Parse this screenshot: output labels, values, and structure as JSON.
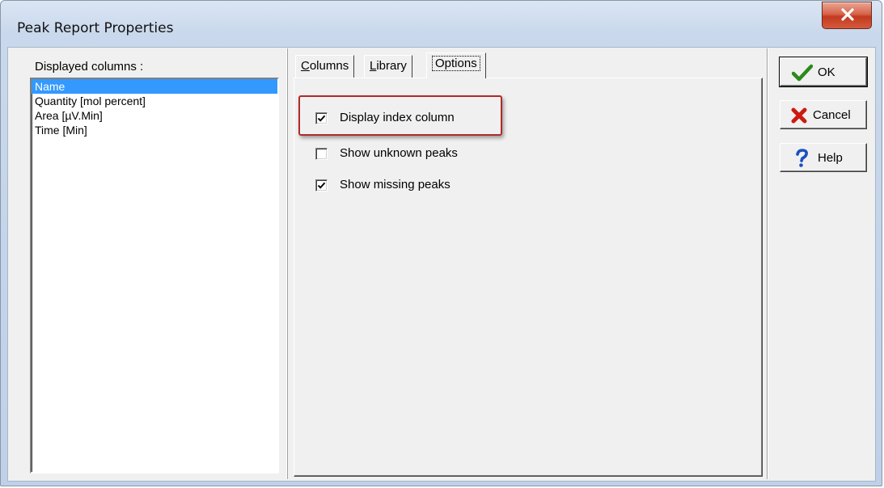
{
  "window": {
    "title": "Peak Report Properties"
  },
  "left_panel": {
    "label": "Displayed columns :",
    "columns": [
      {
        "name": "Name",
        "selected": true
      },
      {
        "name": "Quantity [mol percent]",
        "selected": false
      },
      {
        "name": "Area [µV.Min]",
        "selected": false
      },
      {
        "name": "Time [Min]",
        "selected": false
      }
    ]
  },
  "tabs": [
    {
      "label": "Columns",
      "mnemonic": "C",
      "active": false
    },
    {
      "label": "Library",
      "mnemonic": "L",
      "active": false
    },
    {
      "label": "Options",
      "active": true
    }
  ],
  "options": [
    {
      "label": "Display index column",
      "checked": true,
      "highlighted": true
    },
    {
      "label": "Show unknown peaks",
      "checked": false
    },
    {
      "label": "Show missing peaks",
      "checked": true
    }
  ],
  "buttons": {
    "ok": {
      "label": "OK",
      "icon": "checkmark-icon",
      "color": "#2a8a1a"
    },
    "cancel": {
      "label": "Cancel",
      "icon": "red-x-icon",
      "color": "#cc1a10"
    },
    "help": {
      "label": "Help",
      "icon": "question-mark-icon",
      "color": "#1a4fc0"
    }
  },
  "colors": {
    "selection": "#3399ff",
    "highlight_border": "#b02a2a",
    "close_button": "#c23a1f"
  }
}
